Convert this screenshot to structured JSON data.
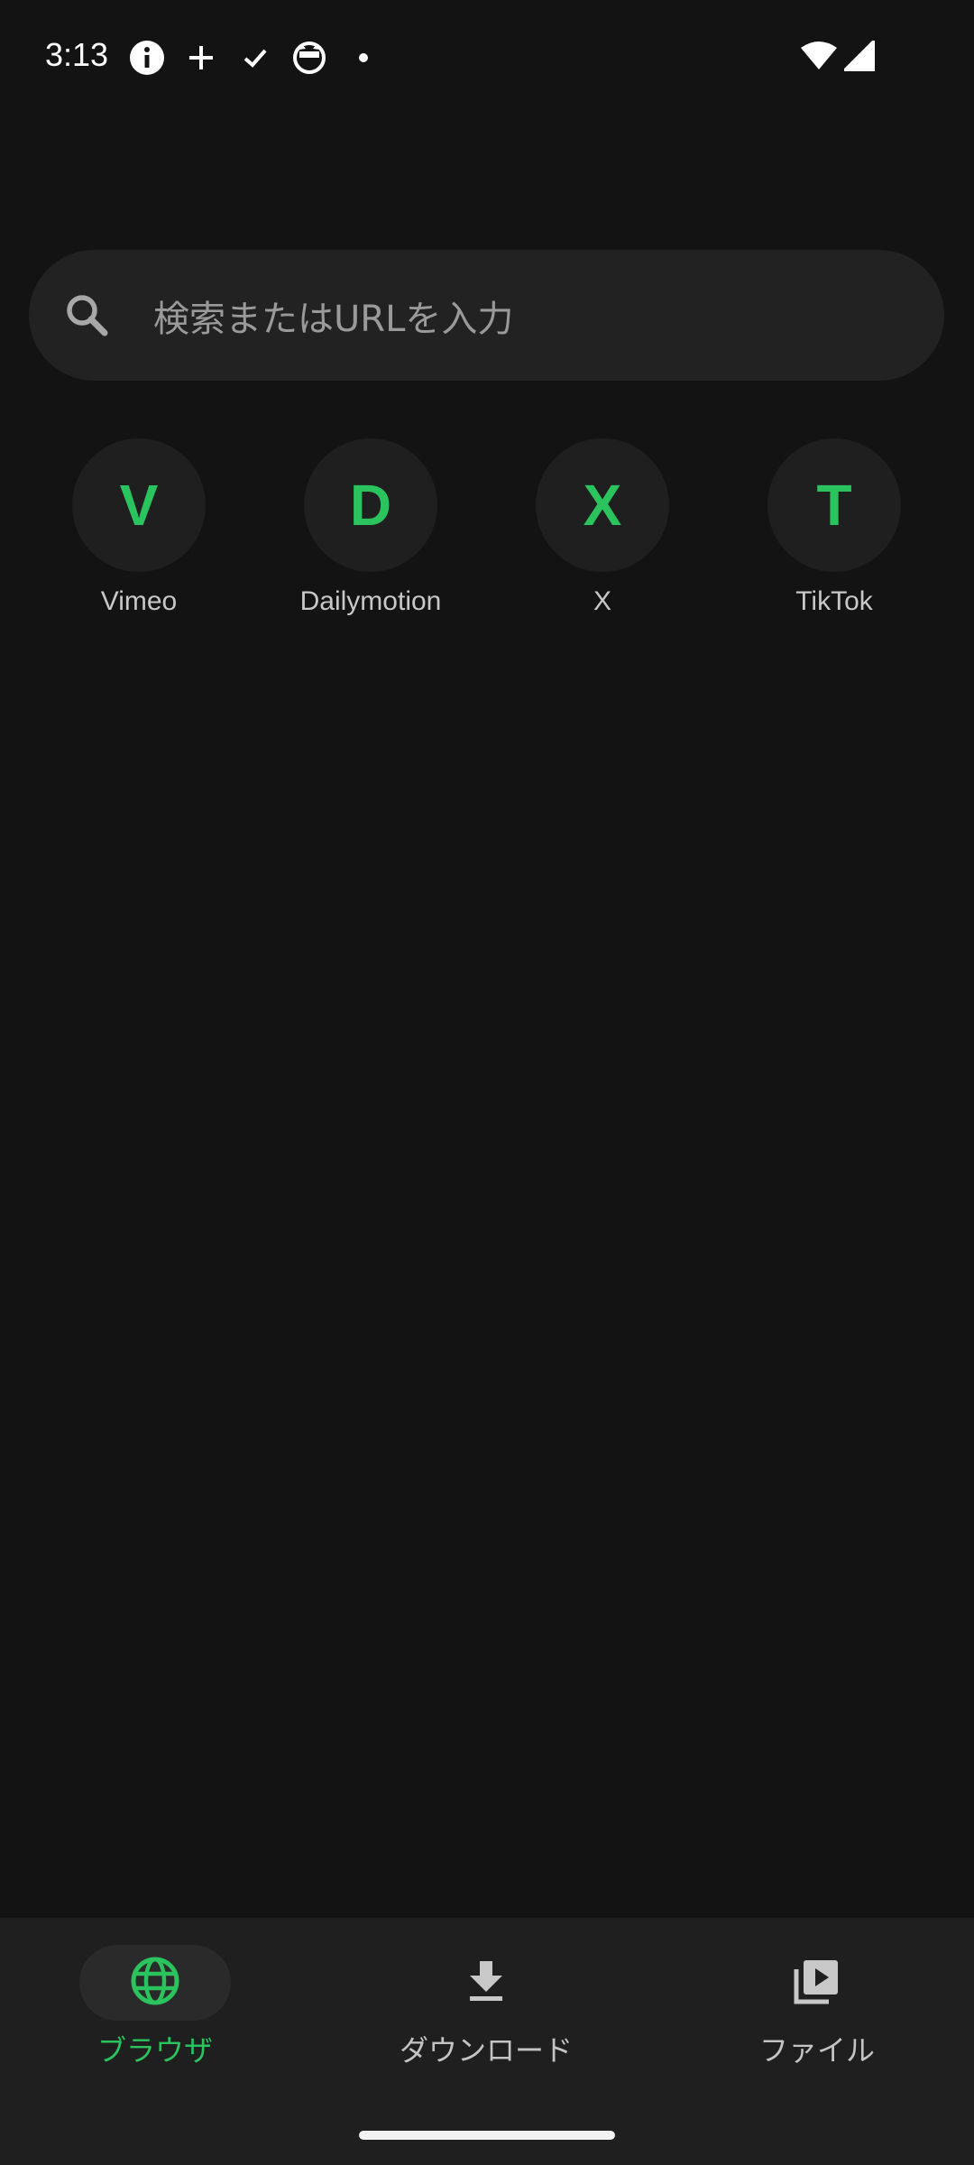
{
  "status_bar": {
    "time": "3:13",
    "left_icons": [
      "info-icon",
      "plus-icon",
      "check-icon",
      "cat-icon",
      "dot-icon"
    ],
    "right_icons": [
      "wifi-icon",
      "signal-icon"
    ]
  },
  "search": {
    "placeholder": "検索またはURLを入力"
  },
  "shortcuts": [
    {
      "letter": "V",
      "label": "Vimeo"
    },
    {
      "letter": "D",
      "label": "Dailymotion"
    },
    {
      "letter": "X",
      "label": "X"
    },
    {
      "letter": "T",
      "label": "TikTok"
    }
  ],
  "bottom_nav": {
    "items": [
      {
        "label": "ブラウザ",
        "icon": "globe-icon",
        "active": true
      },
      {
        "label": "ダウンロード",
        "icon": "download-icon",
        "active": false
      },
      {
        "label": "ファイル",
        "icon": "video-library-icon",
        "active": false
      }
    ]
  },
  "colors": {
    "background": "#131313",
    "surface": "#222222",
    "accent": "#2bc35e",
    "text_secondary": "#9a9a9a"
  }
}
